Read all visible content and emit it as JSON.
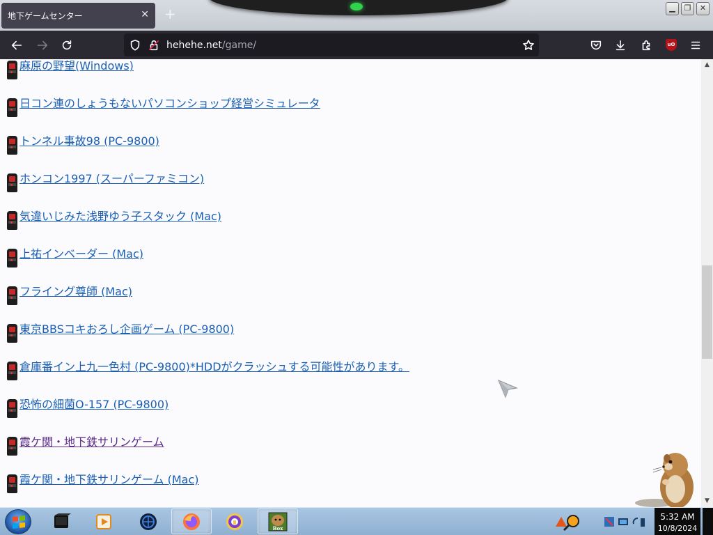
{
  "browser": {
    "tab_title": "地下ゲームセンター",
    "url_host": "hehehe.net",
    "url_path": "/game/"
  },
  "page": {
    "links": [
      {
        "text": "麻原の野望(Windows)",
        "visited": false
      },
      {
        "text": "日コン連のしょうもないパソコンショップ経営シミュレータ",
        "visited": false
      },
      {
        "text": "トンネル事故98 (PC-9800)",
        "visited": false
      },
      {
        "text": "ホンコン1997 (スーパーファミコン)",
        "visited": false
      },
      {
        "text": "気違いじみた浅野ゆう子スタック (Mac)",
        "visited": false
      },
      {
        "text": "上祐インベーダー (Mac)",
        "visited": false
      },
      {
        "text": "フライング尊師 (Mac)",
        "visited": false
      },
      {
        "text": "東京BBSコキおろし企画ゲーム (PC-9800)",
        "visited": false
      },
      {
        "text": "倉庫番イン上九一色村 (PC-9800)*HDDがクラッシュする可能性があります。",
        "visited": false
      },
      {
        "text": "恐怖の細菌O-157 (PC-9800)",
        "visited": false
      },
      {
        "text": "霞ケ関・地下鉄サリンゲーム",
        "visited": true
      },
      {
        "text": "霞ケ関・地下鉄サリンゲーム (Mac)",
        "visited": false
      }
    ],
    "link_icon": "arcade-cabinet-icon"
  },
  "taskbar": {
    "pinned": [
      {
        "name": "media-center-icon"
      },
      {
        "name": "media-player-icon"
      },
      {
        "name": "browser-globe-icon"
      },
      {
        "name": "firefox-icon",
        "active": true
      },
      {
        "name": "private-browser-icon"
      },
      {
        "name": "hamster-box-icon",
        "active": true
      }
    ],
    "box_label": "Box",
    "clock_time": "5:32 AM",
    "clock_date": "10/8/2024"
  },
  "colors": {
    "link": "#1a5fb4",
    "visited": "#5b2a86",
    "toolbar": "#2b2a33",
    "content_bg": "#fbfbfe"
  }
}
